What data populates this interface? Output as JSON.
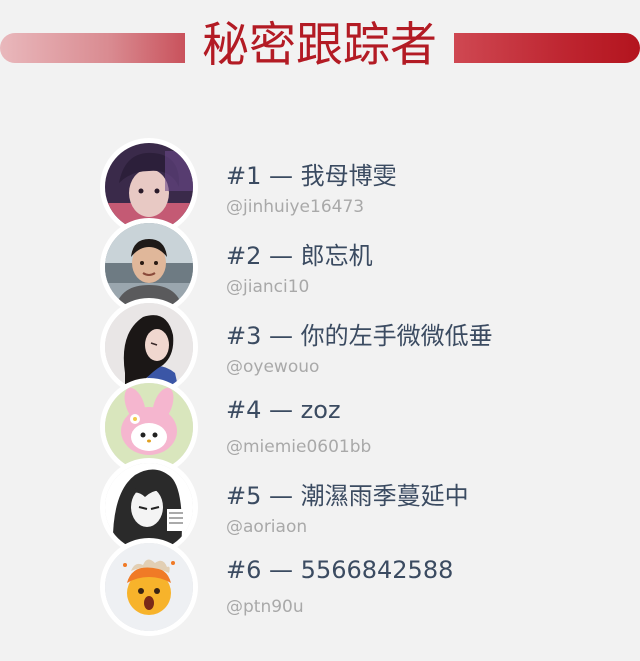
{
  "title": "秘密跟踪者",
  "users": [
    {
      "rank": "#1",
      "separator": "—",
      "name": "我母博雯",
      "handle": "@jinhuiye16473",
      "avatar_icon": "avatar-photo-purple-portrait"
    },
    {
      "rank": "#2",
      "separator": "—",
      "name": "郎忘机",
      "handle": "@jianci10",
      "avatar_icon": "avatar-photo-man-outdoor"
    },
    {
      "rank": "#3",
      "separator": "—",
      "name": "你的左手微微低垂",
      "handle": "@oyewouo",
      "avatar_icon": "avatar-photo-woman-profile"
    },
    {
      "rank": "#4",
      "separator": "—",
      "name": "zoz",
      "handle": "@miemie0601bb",
      "avatar_icon": "avatar-my-melody-illustration"
    },
    {
      "rank": "#5",
      "separator": "—",
      "name": "潮濕雨季蔓延中",
      "handle": "@aoriaon",
      "avatar_icon": "avatar-manga-girl"
    },
    {
      "rank": "#6",
      "separator": "—",
      "name": "5566842588",
      "handle": "@ptn90u",
      "avatar_icon": "avatar-exploding-head-emoji"
    }
  ],
  "colors": {
    "background": "#f2f2f2",
    "title": "#b31b24",
    "name_text": "#3b4b61",
    "handle_text": "#a9a9a9",
    "avatar_border": "#ffffff"
  }
}
